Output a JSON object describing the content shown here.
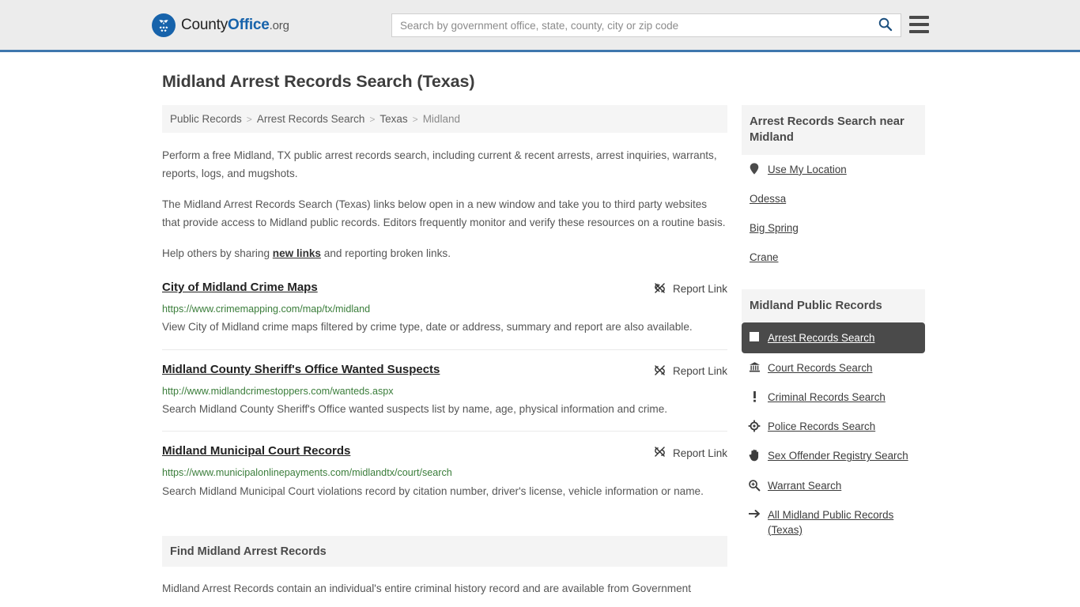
{
  "header": {
    "logo": {
      "icon": "eagle-shield-icon",
      "text_part1": "County",
      "text_part2": "Office",
      "text_part3": ".org"
    },
    "search": {
      "placeholder": "Search by government office, state, county, city or zip code",
      "value": "",
      "search_icon": "search-icon"
    },
    "menu_icon": "hamburger-menu-icon",
    "accent_color": "#3e77ad",
    "background_color": "#ececec"
  },
  "page_title": "Midland Arrest Records Search (Texas)",
  "breadcrumb": {
    "separator": ">",
    "items": [
      {
        "label": "Public Records",
        "current": false
      },
      {
        "label": "Arrest Records Search",
        "current": false
      },
      {
        "label": "Texas",
        "current": false
      },
      {
        "label": "Midland",
        "current": true
      }
    ]
  },
  "intro": {
    "paragraph1": "Perform a free Midland, TX public arrest records search, including current & recent arrests, arrest inquiries, warrants, reports, logs, and mugshots.",
    "paragraph2": "The Midland Arrest Records Search (Texas) links below open in a new window and take you to third party websites that provide access to Midland public records. Editors frequently monitor and verify these resources on a routine basis.",
    "paragraph3_before": "Help others by sharing ",
    "paragraph3_link": "new links",
    "paragraph3_after": " and reporting broken links."
  },
  "report_link_label": "Report Link",
  "report_link_icon": "broken-link-icon",
  "results": [
    {
      "title": "City of Midland Crime Maps",
      "url": "https://www.crimemapping.com/map/tx/midland",
      "description": "View City of Midland crime maps filtered by crime type, date or address, summary and report are also available."
    },
    {
      "title": "Midland County Sheriff's Office Wanted Suspects",
      "url": "http://www.midlandcrimestoppers.com/wanteds.aspx",
      "description": "Search Midland County Sheriff's Office wanted suspects list by name, age, physical information and crime."
    },
    {
      "title": "Midland Municipal Court Records",
      "url": "https://www.municipalonlinepayments.com/midlandtx/court/search",
      "description": "Search Midland Municipal Court violations record by citation number, driver's license, vehicle information or name."
    }
  ],
  "find_section": {
    "heading": "Find Midland Arrest Records",
    "body": "Midland Arrest Records contain an individual's entire criminal history record and are available from Government"
  },
  "sidebar": {
    "near_card": {
      "heading": "Arrest Records Search near Midland",
      "items": [
        {
          "label": "Use My Location",
          "icon": "map-pin-icon",
          "has_icon": true
        },
        {
          "label": "Odessa",
          "icon": "",
          "has_icon": false
        },
        {
          "label": "Big Spring",
          "icon": "",
          "has_icon": false
        },
        {
          "label": "Crane",
          "icon": "",
          "has_icon": false
        }
      ]
    },
    "public_records_card": {
      "heading": "Midland Public Records",
      "active_background": "#4a4a4a",
      "items": [
        {
          "label": "Arrest Records Search",
          "icon": "white-square-icon",
          "active": true
        },
        {
          "label": "Court Records Search",
          "icon": "courthouse-bank-icon",
          "active": false
        },
        {
          "label": "Criminal Records Search",
          "icon": "exclamation-mark-icon",
          "active": false
        },
        {
          "label": "Police Records Search",
          "icon": "crosshair-target-icon",
          "active": false
        },
        {
          "label": "Sex Offender Registry Search",
          "icon": "hand-icon",
          "active": false
        },
        {
          "label": "Warrant Search",
          "icon": "magnifier-plus-icon",
          "active": false
        },
        {
          "label": "All Midland Public Records (Texas)",
          "icon": "arrow-right-icon",
          "active": false
        }
      ]
    }
  }
}
